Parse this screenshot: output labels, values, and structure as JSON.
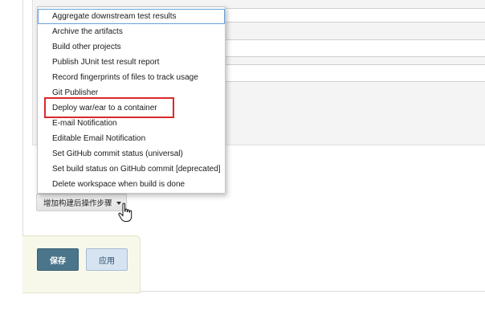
{
  "post_build_menu": {
    "items": [
      {
        "label": "Aggregate downstream test results"
      },
      {
        "label": "Archive the artifacts"
      },
      {
        "label": "Build other projects"
      },
      {
        "label": "Publish JUnit test result report"
      },
      {
        "label": "Record fingerprints of files to track usage"
      },
      {
        "label": "Git Publisher"
      },
      {
        "label": "Deploy war/ear to a container"
      },
      {
        "label": "E-mail Notification"
      },
      {
        "label": "Editable Email Notification"
      },
      {
        "label": "Set GitHub commit status (universal)"
      },
      {
        "label": "Set build status on GitHub commit [deprecated]"
      },
      {
        "label": "Delete workspace when build is done"
      }
    ],
    "highlighted_item": "Deploy war/ear to a container",
    "highlight_color": "#d9292b"
  },
  "add_post_build_button": {
    "label": "增加构建后操作步骤"
  },
  "footer": {
    "save_label": "保存",
    "apply_label": "应用"
  },
  "colors": {
    "save_button": "#4b758b",
    "apply_button": "#d6e3f1"
  }
}
